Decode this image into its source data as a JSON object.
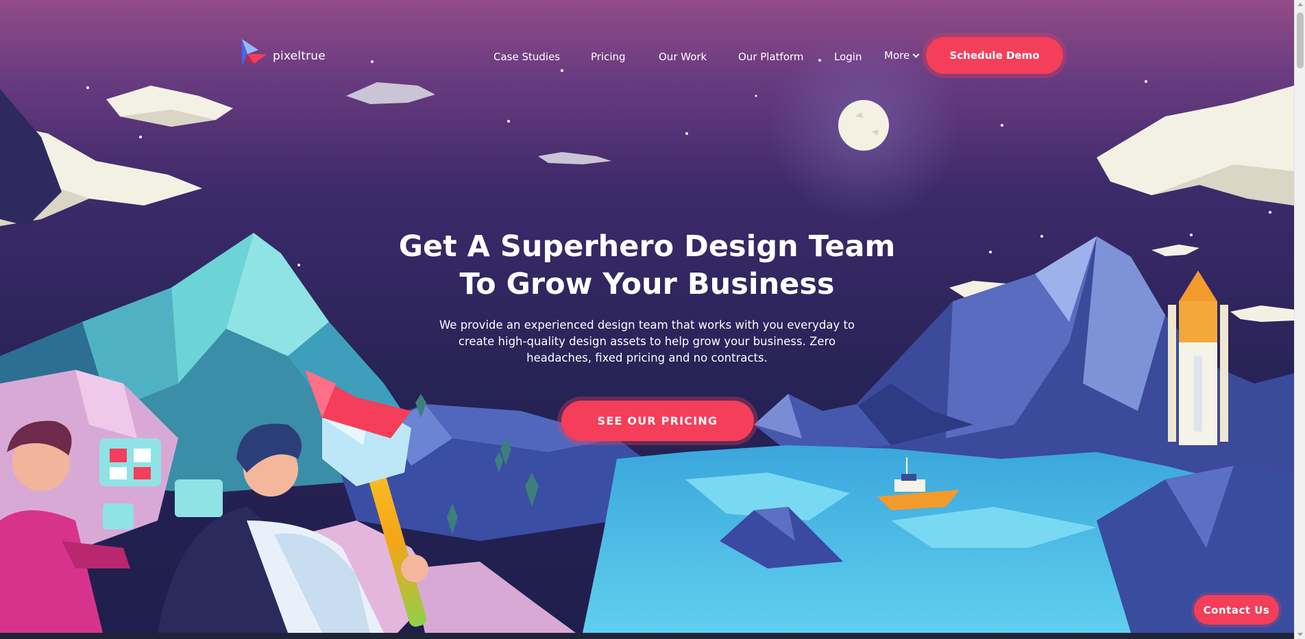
{
  "brand": {
    "name": "pixeltrue",
    "logo_icon": "paper-plane-logo-icon"
  },
  "nav": {
    "links": [
      {
        "label": "Case Studies"
      },
      {
        "label": "Pricing"
      },
      {
        "label": "Our Work"
      },
      {
        "label": "Our Platform"
      },
      {
        "label": "Login"
      }
    ],
    "more_label": "More",
    "more_icon": "chevron-down-icon",
    "cta_label": "Schedule Demo"
  },
  "hero": {
    "title_line1": "Get A Superhero Design Team",
    "title_line2": "To Grow Your Business",
    "subtitle": "We provide an experienced design team that works with you everyday to create high-quality design assets to help grow your business. Zero headaches, fixed pricing and no contracts.",
    "cta_label": "SEE OUR PRICING"
  },
  "contact_label": "Contact Us",
  "colors": {
    "accent": "#f43e5a",
    "sky_top": "#8f4a86",
    "sky_bottom": "#282356",
    "water": "#4fc2e8",
    "mountain_blue": "#3d4fa0",
    "mountain_teal": "#5fc7c9"
  }
}
